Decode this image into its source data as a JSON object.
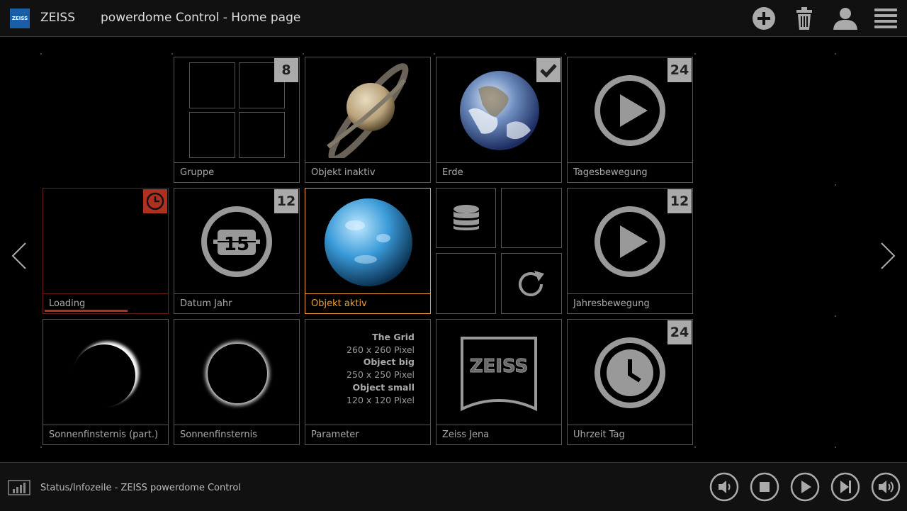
{
  "header": {
    "logo_text": "ZEISS",
    "brand": "ZEISS",
    "title": "powerdome Control - Home page",
    "icons": [
      "add-icon",
      "trash-icon",
      "user-icon",
      "menu-icon"
    ]
  },
  "tiles": {
    "gruppe": {
      "label": "Gruppe",
      "badge": "8"
    },
    "objekt_inaktiv": {
      "label": "Objekt inaktiv"
    },
    "erde": {
      "label": "Erde",
      "badge_icon": "check-icon"
    },
    "tagesbewegung": {
      "label": "Tagesbewegung",
      "badge": "24"
    },
    "loading": {
      "label": "Loading",
      "badge_icon": "clock-icon",
      "progress": 0.67,
      "accent": "#b03020"
    },
    "datum_jahr": {
      "label": "Datum Jahr",
      "badge": "12",
      "icon_text": "15"
    },
    "objekt_aktiv": {
      "label": "Objekt aktiv",
      "accent": "#f0a030"
    },
    "jahresbewegung": {
      "label": "Jahresbewegung",
      "badge": "12"
    },
    "sonnenfinsternis_part": {
      "label": "Sonnenfinsternis (part.)"
    },
    "sonnenfinsternis": {
      "label": "Sonnenfinsternis"
    },
    "parameter": {
      "label": "Parameter",
      "lines": [
        "The Grid",
        "260 x 260 Pixel",
        "Object big",
        "250 x 250 Pixel",
        "Object small",
        "120 x 120 Pixel"
      ]
    },
    "zeiss_jena": {
      "label": "Zeiss Jena",
      "logo_text": "ZEISS"
    },
    "uhrzeit_tag": {
      "label": "Uhrzeit Tag",
      "badge": "24"
    }
  },
  "footer": {
    "status": "Status/Infozeile - ZEISS powerdome Control",
    "controls": [
      "volume-down-icon",
      "stop-icon",
      "play-icon",
      "skip-next-icon",
      "volume-up-icon"
    ]
  },
  "nav": {
    "prev": "chevron-left-icon",
    "next": "chevron-right-icon"
  }
}
